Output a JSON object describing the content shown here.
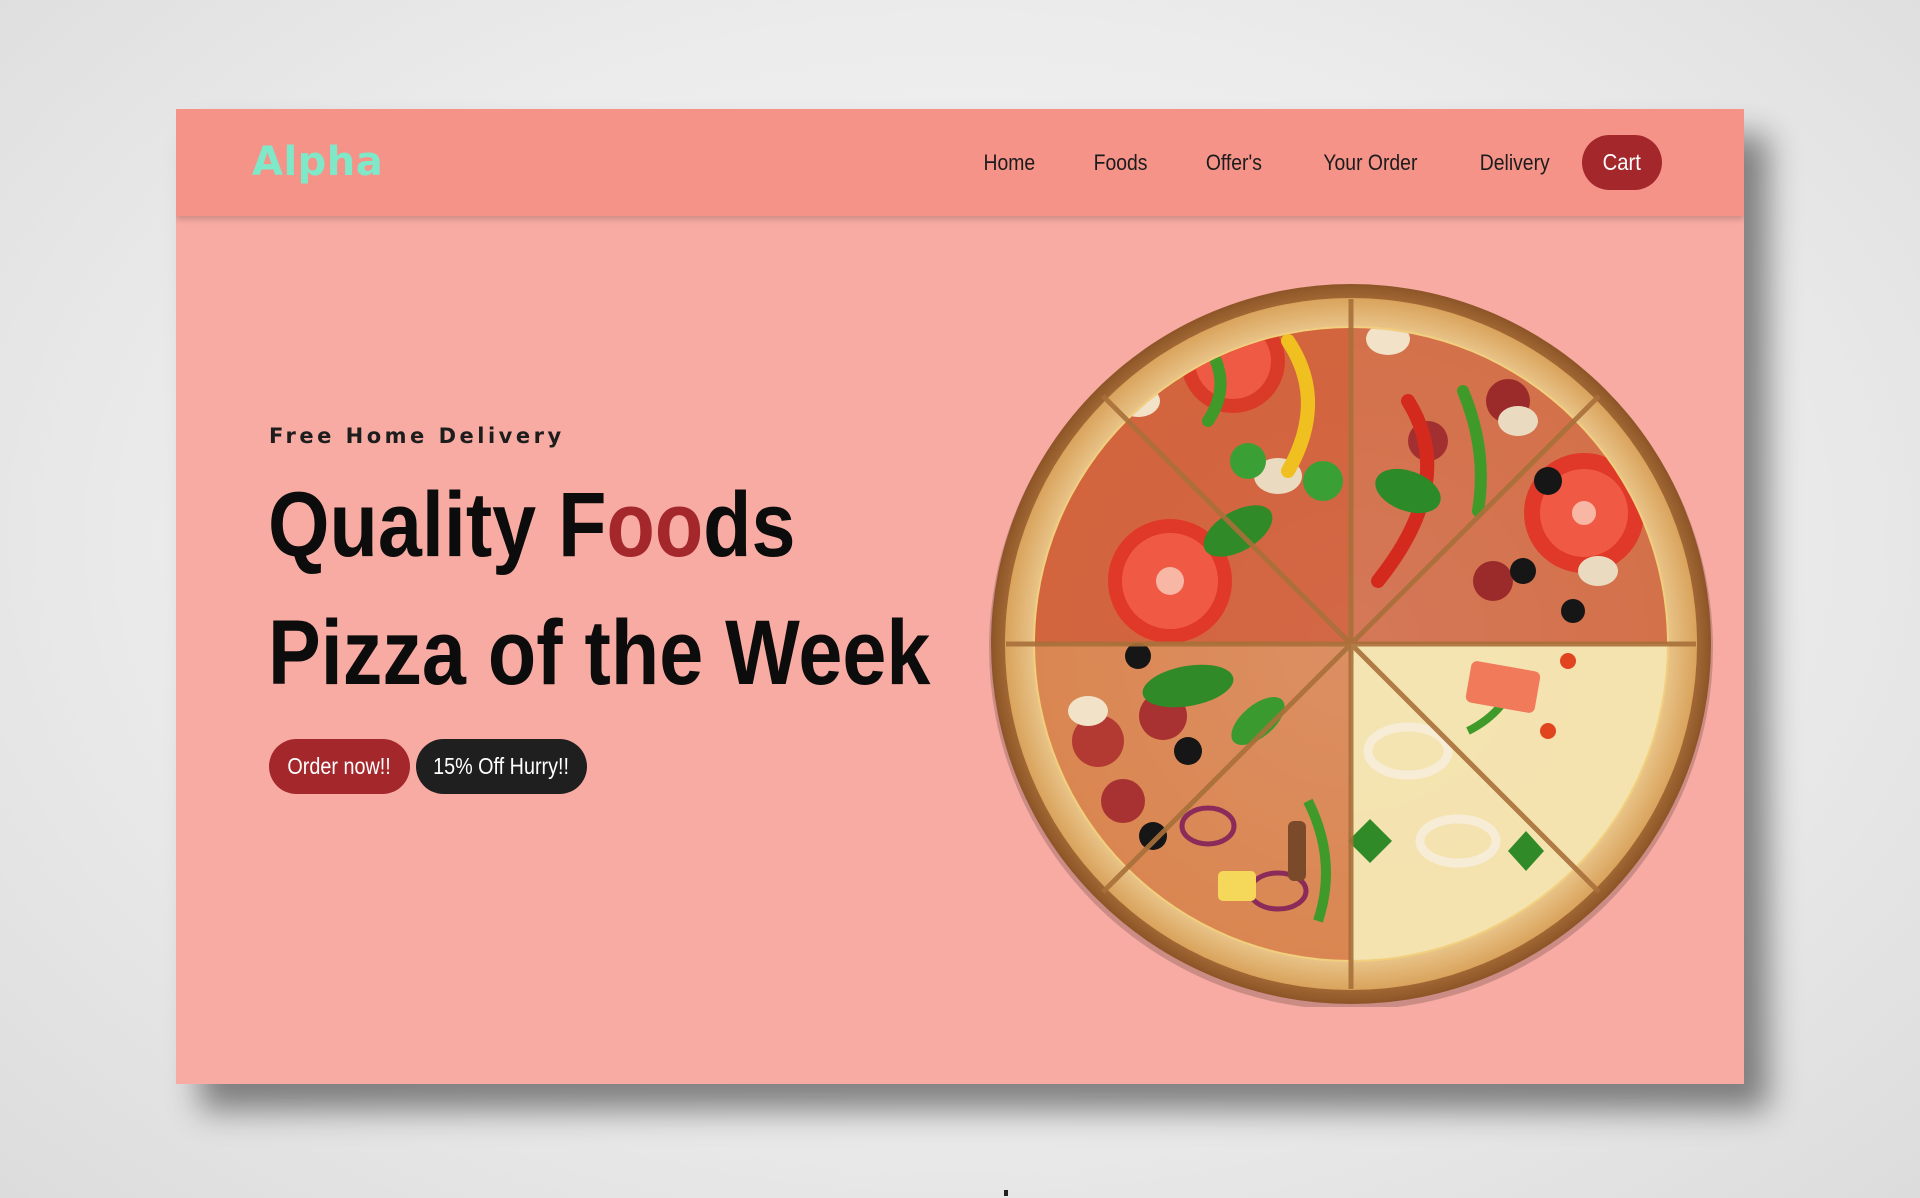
{
  "brand": {
    "logo": "Alpha",
    "logo_color": "#7ee8c8",
    "accent_color": "#a3272b",
    "navbar_color": "#f59389",
    "hero_background": "#f7aba2"
  },
  "nav": {
    "items": [
      {
        "label": "Home"
      },
      {
        "label": "Foods"
      },
      {
        "label": "Offer's"
      },
      {
        "label": "Your Order"
      },
      {
        "label": "Delivery"
      }
    ],
    "cart_label": "Cart"
  },
  "hero": {
    "subtitle": "Free Home Delivery",
    "title_line1_part1": "Quality F",
    "title_line1_accent": "oo",
    "title_line1_part2": "ds",
    "title_line2": "Pizza of the Week",
    "order_button": "Order now!!",
    "offer_button": "15% Off Hurry!!",
    "image_icon": "pizza-image"
  }
}
